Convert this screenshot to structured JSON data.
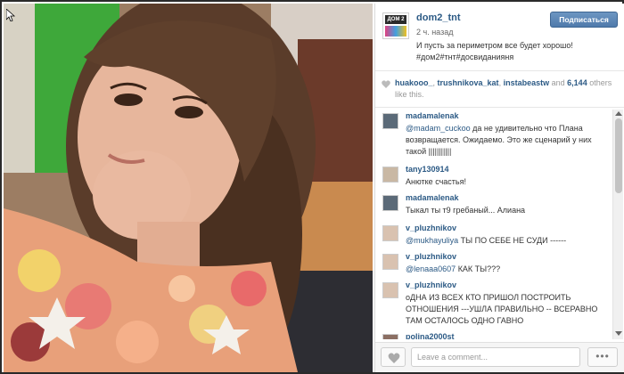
{
  "post": {
    "username": "dom2_tnt",
    "follow_label": "Подписаться",
    "time": "2 ч. назад",
    "caption": "И пусть за периметром все будет хорошо! #дом2#тнт#досвиданияня",
    "logo_text": "ДОМ 2"
  },
  "likes": {
    "user1": "huakooo_",
    "user2": "trushnikova_kat",
    "user3": "instabeastw",
    "and": "and",
    "count": "6,144",
    "suffix": "others like this."
  },
  "comments": [
    {
      "user": "madamalenak",
      "mention": "@madam_cuckoo",
      "text": " да не удивительно что Плана возвращается. Ожидаемо. Это же сценарий у них такой |||||||||||"
    },
    {
      "user": "tany130914",
      "mention": "",
      "text": "Анютке счастья!"
    },
    {
      "user": "madamalenak",
      "mention": "",
      "text": "Тыкал ты т9 гребаный... Алиана"
    },
    {
      "user": "v_pluzhnikov",
      "mention": "@mukhayuliya",
      "text": " ТЫ ПО СЕБЕ НЕ СУДИ ------"
    },
    {
      "user": "v_pluzhnikov",
      "mention": "@lenaaa0607",
      "text": " КАК ТЫ???"
    },
    {
      "user": "v_pluzhnikov",
      "mention": "",
      "text": "оДНА ИЗ ВСЕХ КТО ПРИШОЛ ПОСТРОИТЬ ОТНОШЕНИЯ ---УШЛА ПРАВИЛЬНО -- ВСЕРАВНО ТАМ ОСТАЛОСЬ ОДНО ГАВНО"
    },
    {
      "user": "polina2000st",
      "mention": "",
      "text": ""
    }
  ],
  "footer": {
    "placeholder": "Leave a comment...",
    "more_label": "•••"
  },
  "colors": {
    "link": "#2c5a85",
    "button": "#5a84b5"
  }
}
